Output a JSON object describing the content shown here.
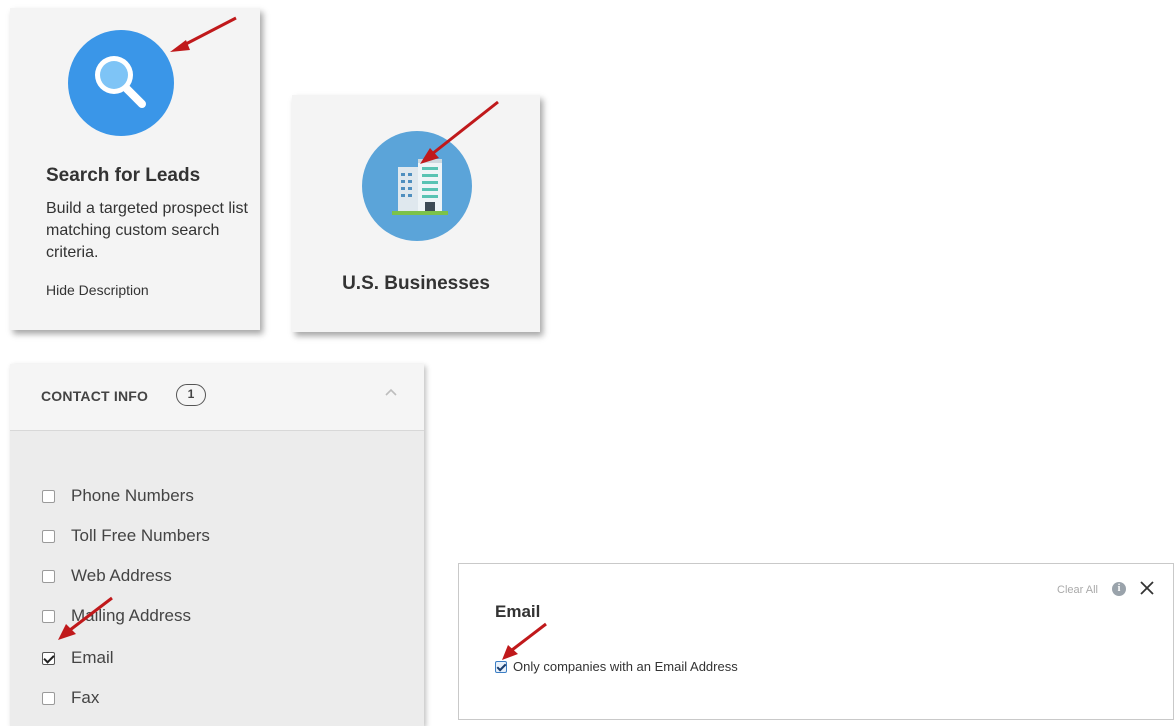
{
  "leads_card": {
    "icon": "search-icon",
    "title": "Search for Leads",
    "description": "Build a targeted prospect list matching custom search criteria.",
    "hide_link": "Hide Description"
  },
  "business_card": {
    "icon": "building-icon",
    "title": "U.S. Businesses"
  },
  "contact_info": {
    "title": "CONTACT INFO",
    "count": "1",
    "options": [
      {
        "label": "Phone Numbers",
        "checked": false
      },
      {
        "label": "Toll Free Numbers",
        "checked": false
      },
      {
        "label": "Web Address",
        "checked": false
      },
      {
        "label": "Mailing Address",
        "checked": false
      },
      {
        "label": "Email",
        "checked": true
      },
      {
        "label": "Fax",
        "checked": false
      }
    ]
  },
  "email_filter": {
    "title": "Email",
    "clear_all": "Clear All",
    "info_glyph": "i",
    "option_label": "Only companies with an Email Address",
    "option_checked": true
  },
  "colors": {
    "search_circle": "#3a96e8",
    "building_circle": "#5ba4d9",
    "arrow": "#c0191b"
  }
}
